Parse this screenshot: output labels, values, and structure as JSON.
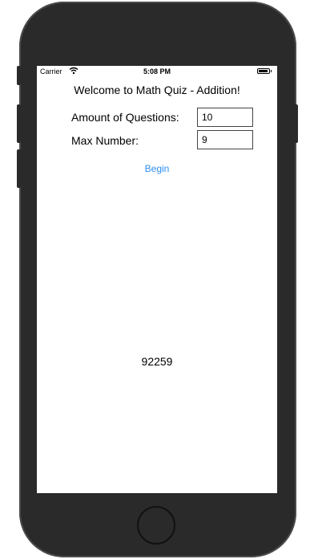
{
  "status_bar": {
    "carrier": "Carrier",
    "time": "5:08 PM",
    "battery_level": 0.9,
    "wifi_icon": "wifi-icon",
    "battery_icon": "battery-icon"
  },
  "screen": {
    "title": "Welcome to Math Quiz - Addition!",
    "questions": {
      "label": "Amount of Questions:",
      "value": "10"
    },
    "max_number": {
      "label": "Max Number:",
      "value": "9"
    },
    "begin_label": "Begin",
    "result_text": "92259"
  },
  "colors": {
    "phone_body": "#2a2a2a",
    "link_blue": "#2f8ef0"
  }
}
